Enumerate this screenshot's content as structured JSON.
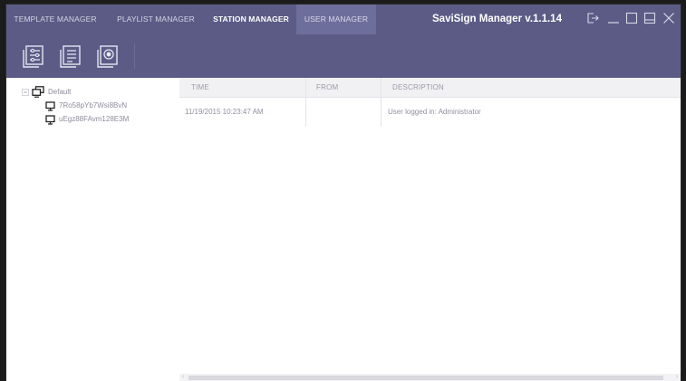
{
  "app": {
    "title": "SaviSign Manager v.1.1.14",
    "accent": "#5b5b86"
  },
  "tabs": [
    {
      "label": "TEMPLATE MANAGER",
      "active": false
    },
    {
      "label": "PLAYLIST MANAGER",
      "active": false
    },
    {
      "label": "STATION MANAGER",
      "active": true
    },
    {
      "label": "USER MANAGER",
      "active": false
    }
  ],
  "window_controls": [
    "logout-icon",
    "minimize-icon",
    "maximize-icon",
    "restore-icon",
    "close-icon"
  ],
  "toolbar": {
    "buttons": [
      "station-settings-icon",
      "station-list-icon",
      "station-monitor-icon"
    ]
  },
  "tree": {
    "root": {
      "label": "Default",
      "icon": "monitor-group-icon"
    },
    "children": [
      {
        "label": "7Ro58pYb7Wsi8BvN",
        "icon": "monitor-icon"
      },
      {
        "label": "uEgz88FAvm128E3M",
        "icon": "monitor-icon"
      }
    ]
  },
  "log": {
    "columns": [
      "TIME",
      "FROM",
      "DESCRIPTION"
    ],
    "rows": [
      {
        "time": "11/19/2015 10:23:47 AM",
        "from": "",
        "description": "User logged in: Administrator"
      }
    ]
  }
}
